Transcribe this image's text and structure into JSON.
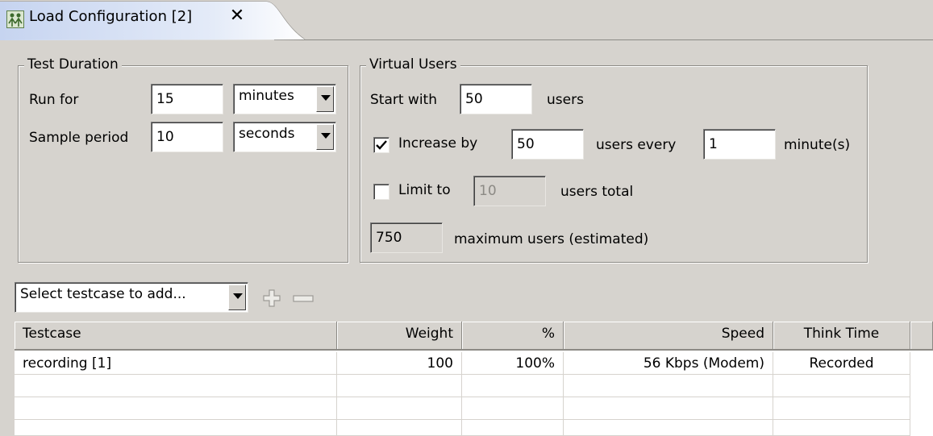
{
  "tab": {
    "title": "Load Configuration [2]",
    "icon": "users-icon",
    "close_icon": "close-icon"
  },
  "test_duration": {
    "legend": "Test Duration",
    "run_for_label": "Run for",
    "run_for_value": "15",
    "run_for_unit": "minutes",
    "sample_period_label": "Sample period",
    "sample_period_value": "10",
    "sample_period_unit": "seconds"
  },
  "virtual_users": {
    "legend": "Virtual Users",
    "start_with_label": "Start with",
    "start_with_value": "50",
    "start_with_suffix": "users",
    "increase_checked": true,
    "increase_label": "Increase by",
    "increase_value": "50",
    "increase_mid": "users every",
    "increase_interval": "1",
    "increase_suffix": "minute(s)",
    "limit_checked": false,
    "limit_label": "Limit to",
    "limit_value": "10",
    "limit_suffix": "users total",
    "max_value": "750",
    "max_suffix": "maximum users (estimated)"
  },
  "testcase_toolbar": {
    "select_text": "Select testcase to add...",
    "add_icon": "add-icon",
    "remove_icon": "remove-icon"
  },
  "table": {
    "columns": [
      "Testcase",
      "Weight",
      "%",
      "Speed",
      "Think Time"
    ],
    "rows": [
      [
        "recording [1]",
        "100",
        "100%",
        "56 Kbps (Modem)",
        "Recorded"
      ]
    ]
  }
}
